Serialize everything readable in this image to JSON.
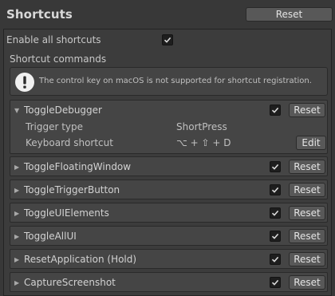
{
  "header": {
    "title": "Shortcuts",
    "reset_label": "Reset"
  },
  "settings": {
    "enable_all_label": "Enable all shortcuts",
    "enable_all_checked": true,
    "commands_header": "Shortcut commands"
  },
  "info": {
    "icon": "info-exclamation-icon",
    "text": "The control key on macOS is not supported for shortcut registration."
  },
  "commands": [
    {
      "name": "ToggleDebugger",
      "expanded": true,
      "enabled": true,
      "reset_label": "Reset",
      "trigger_type_label": "Trigger type",
      "trigger_type_value": "ShortPress",
      "keyboard_shortcut_label": "Keyboard shortcut",
      "keyboard_shortcut_value": "⌥ + ⇧ + D",
      "edit_label": "Edit"
    },
    {
      "name": "ToggleFloatingWindow",
      "expanded": false,
      "enabled": true,
      "reset_label": "Reset"
    },
    {
      "name": "ToggleTriggerButton",
      "expanded": false,
      "enabled": true,
      "reset_label": "Reset"
    },
    {
      "name": "ToggleUIElements",
      "expanded": false,
      "enabled": true,
      "reset_label": "Reset"
    },
    {
      "name": "ToggleAllUI",
      "expanded": false,
      "enabled": true,
      "reset_label": "Reset"
    },
    {
      "name": "ResetApplication (Hold)",
      "expanded": false,
      "enabled": true,
      "reset_label": "Reset"
    },
    {
      "name": "CaptureScreenshot",
      "expanded": false,
      "enabled": true,
      "reset_label": "Reset"
    }
  ],
  "colors": {
    "background": "#383838",
    "panel": "#3c3c3c",
    "item": "#454545",
    "button": "#585858",
    "text": "#c8c8c8"
  }
}
